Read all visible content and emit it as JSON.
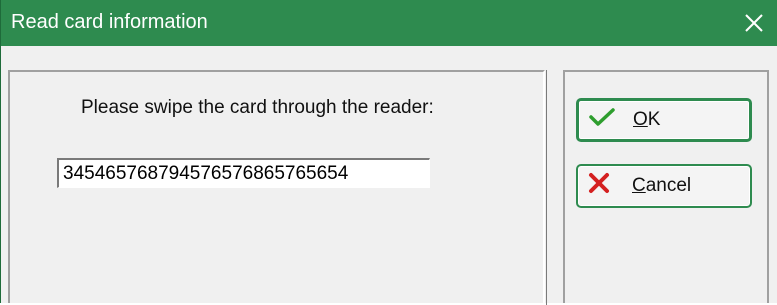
{
  "window": {
    "title": "Read card information",
    "titlebar_color": "#2e8b4f"
  },
  "close": {
    "icon": "close-icon"
  },
  "content": {
    "prompt": "Please swipe the card through the reader:",
    "card_number": "34546576879457657686576565​4"
  },
  "buttons": {
    "ok": {
      "mnemonic": "O",
      "rest": "K",
      "icon": "checkmark-icon",
      "icon_color": "#2e9e2e"
    },
    "cancel": {
      "mnemonic": "C",
      "rest": "ancel",
      "icon": "cross-icon",
      "icon_color": "#d42020"
    }
  }
}
